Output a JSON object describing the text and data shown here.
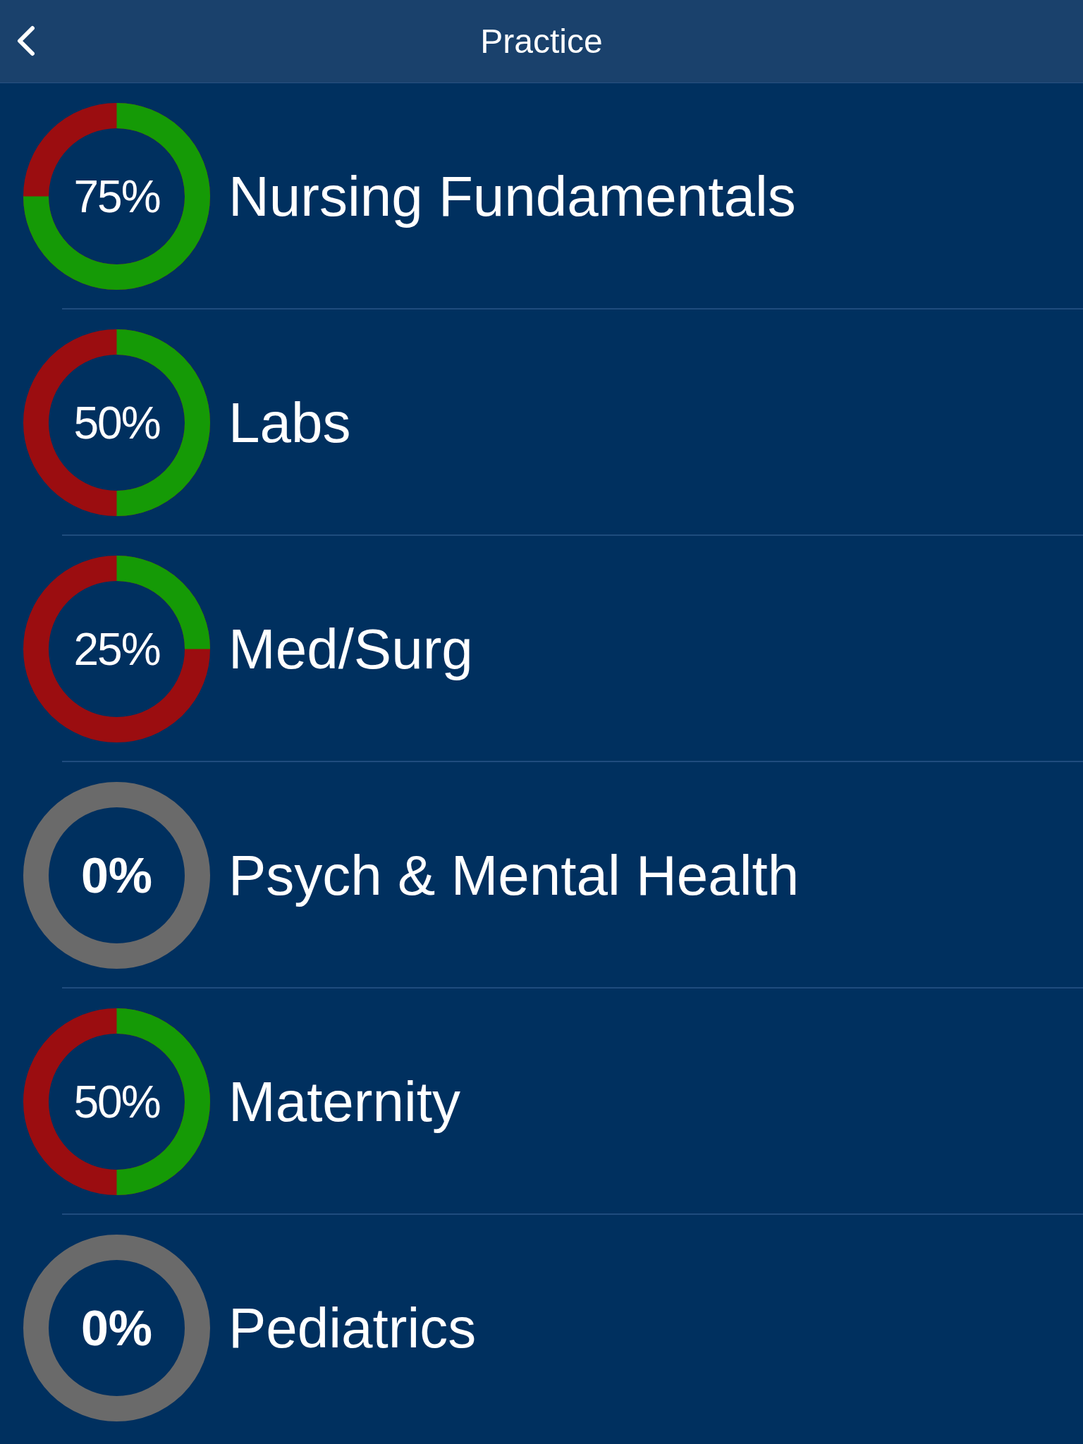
{
  "header": {
    "title": "Practice"
  },
  "items": [
    {
      "label": "Nursing Fundamentals",
      "percent": "75%",
      "level": 0.75
    },
    {
      "label": "Labs",
      "percent": "50%",
      "level": 0.5
    },
    {
      "label": "Med/Surg",
      "percent": "25%",
      "level": 0.25
    },
    {
      "label": "Psych & Mental Health",
      "percent": "0%",
      "level": 0
    },
    {
      "label": "Maternity",
      "percent": "50%",
      "level": 0.5
    },
    {
      "label": "Pediatrics",
      "percent": "0%",
      "level": 0
    }
  ]
}
